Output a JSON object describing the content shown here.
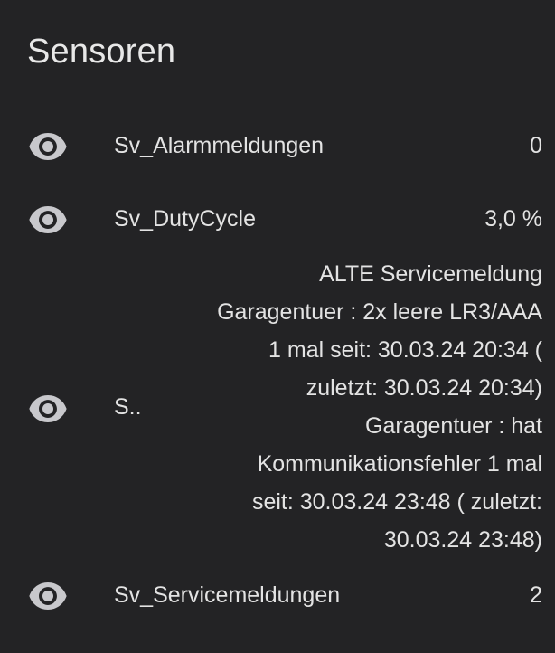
{
  "card": {
    "title": "Sensoren"
  },
  "rows": [
    {
      "icon": "eye-icon",
      "name": "Sv_Alarmmeldungen",
      "value": "0"
    },
    {
      "icon": "eye-icon",
      "name": "Sv_DutyCycle",
      "value": "3,0 %"
    },
    {
      "icon": "eye-icon",
      "name": "S..",
      "value_lines": [
        "ALTE Servicemeldung",
        "Garagentuer :  2x leere LR3/AAA",
        "1 mal seit: 30.03.24 20:34 (",
        "zuletzt: 30.03.24 20:34)",
        "Garagentuer :  hat",
        "Kommunikationsfehler  1 mal",
        "seit: 30.03.24 23:48 ( zuletzt:",
        "30.03.24 23:48)"
      ]
    },
    {
      "icon": "eye-icon",
      "name": "Sv_Servicemeldungen",
      "value": "2"
    }
  ],
  "colors": {
    "background": "#232325",
    "text": "#e3e3e3",
    "icon": "#c8c8cc"
  }
}
